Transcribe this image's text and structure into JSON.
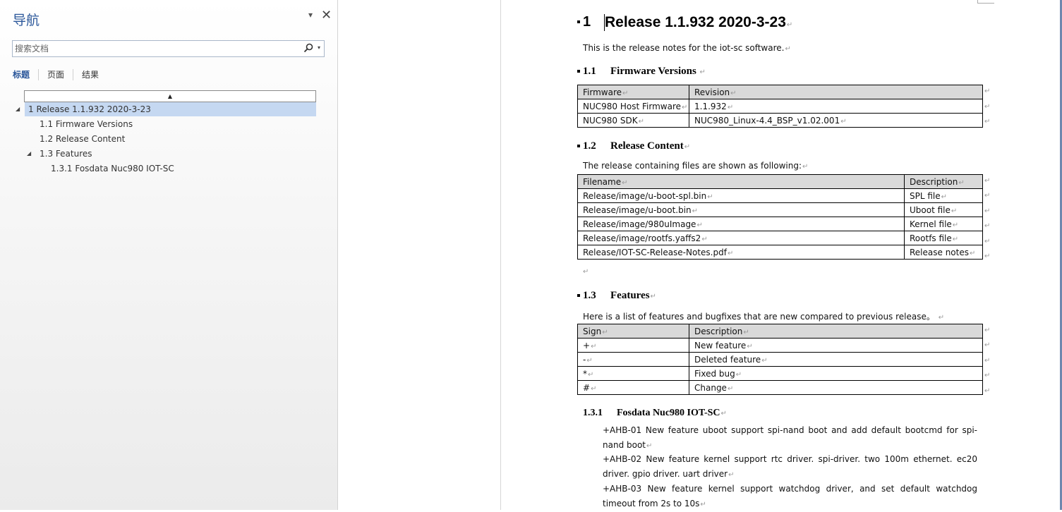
{
  "nav": {
    "title": "导航",
    "dropdown_glyph": "▾",
    "close_glyph": "✕",
    "search": {
      "placeholder": "搜索文档",
      "value": "",
      "icon": "search-icon",
      "dropdown_glyph": "▾"
    },
    "tabs": [
      {
        "label": "标题",
        "active": true
      },
      {
        "label": "页面",
        "active": false
      },
      {
        "label": "结果",
        "active": false
      }
    ],
    "collapse_glyph": "▲",
    "tree": [
      {
        "label": "1 Release 1.1.932 2020-3-23",
        "level": 1,
        "expanded": true,
        "selected": true
      },
      {
        "label": "1.1 Firmware Versions",
        "level": 2
      },
      {
        "label": "1.2 Release Content",
        "level": 2
      },
      {
        "label": "1.3 Features",
        "level": 2,
        "expanded": true
      },
      {
        "label": "1.3.1 Fosdata Nuc980 IOT-SC",
        "level": 3
      }
    ],
    "expanded_glyph": "◢"
  },
  "doc": {
    "paragraph_mark": "↵",
    "h1": {
      "num": "1",
      "text": "Release 1.1.932 2020-3-23"
    },
    "intro": "This is the release notes for the iot-sc software.",
    "s11": {
      "num": "1.1",
      "title": "Firmware Versions"
    },
    "fw_table": {
      "headers": [
        "Firmware",
        "Revision"
      ],
      "rows": [
        [
          "NUC980 Host Firmware",
          "1.1.932"
        ],
        [
          "NUC980 SDK",
          "NUC980_Linux-4.4_BSP_v1.02.001"
        ]
      ]
    },
    "s12": {
      "num": "1.2",
      "title": "Release Content"
    },
    "s12_intro": "The release containing files are shown as following:",
    "files_table": {
      "headers": [
        "Filename",
        "Description"
      ],
      "rows": [
        [
          "Release/image/u-boot-spl.bin",
          "SPL file"
        ],
        [
          "Release/image/u-boot.bin",
          "Uboot file"
        ],
        [
          "Release/image/980uImage",
          "Kernel file"
        ],
        [
          "Release/image/rootfs.yaffs2",
          "Rootfs file"
        ],
        [
          "Release/IOT-SC-Release-Notes.pdf",
          "Release notes"
        ]
      ]
    },
    "s13": {
      "num": "1.3",
      "title": "Features"
    },
    "s13_intro": "Here is a list of features and bugfixes that are new compared to previous release。",
    "features_table": {
      "headers": [
        "Sign",
        "Description"
      ],
      "rows": [
        [
          "+",
          "New feature"
        ],
        [
          "-",
          "Deleted feature"
        ],
        [
          "*",
          "Fixed bug"
        ],
        [
          "#",
          "Change"
        ]
      ]
    },
    "s131": {
      "num": "1.3.1",
      "title": "Fosdata Nuc980 IOT-SC"
    },
    "items": [
      "+AHB-01 New feature uboot support spi-nand boot and add default bootcmd for spi-nand boot",
      "+AHB-02 New feature kernel support rtc driver. spi-driver. two 100m ethernet. ec20 driver. gpio driver. uart driver",
      "+AHB-03 New feature kernel support watchdog driver, and set default watchdog timeout from 2s to 10s"
    ]
  }
}
